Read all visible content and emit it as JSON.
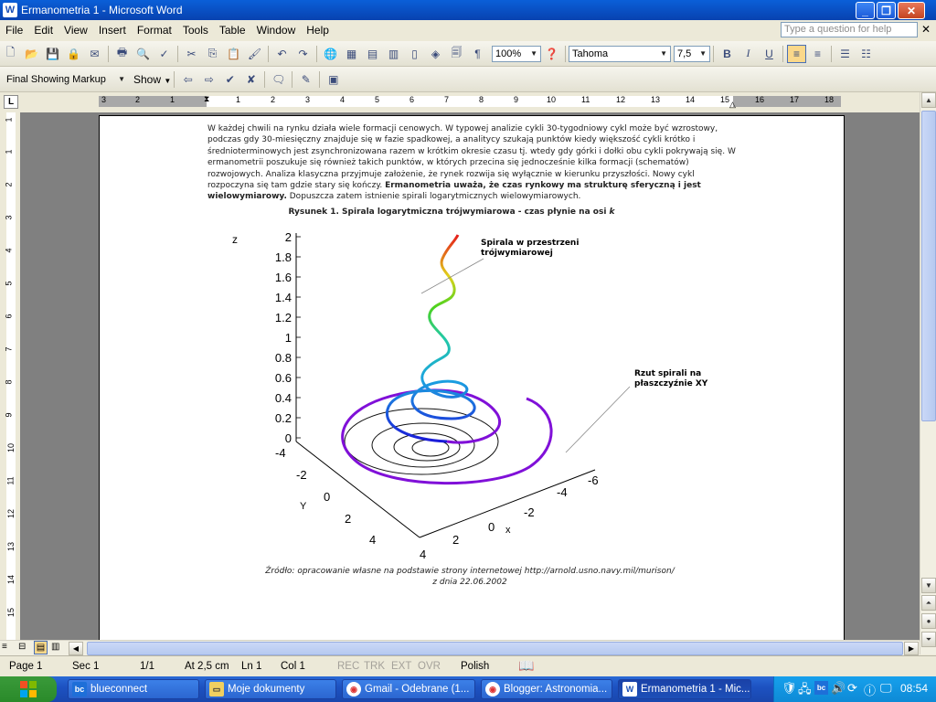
{
  "window": {
    "title": "Ermanometria 1 - Microsoft Word",
    "app_icon": "W"
  },
  "menu": [
    "File",
    "Edit",
    "View",
    "Insert",
    "Format",
    "Tools",
    "Table",
    "Window",
    "Help"
  ],
  "help_box": {
    "placeholder": "Type a question for help"
  },
  "standard_toolbar": {
    "zoom": "100%",
    "font": "Tahoma",
    "size": "7,5"
  },
  "reviewing_toolbar": {
    "display_mode": "Final Showing Markup",
    "show_label": "Show"
  },
  "ruler": {
    "numbers": [
      "3",
      "2",
      "1",
      "1",
      "2",
      "3",
      "4",
      "5",
      "6",
      "7",
      "8",
      "9",
      "10",
      "11",
      "12",
      "13",
      "14",
      "15",
      "16",
      "17",
      "18"
    ]
  },
  "vruler": {
    "numbers": [
      "1",
      "1",
      "2",
      "3",
      "4",
      "5",
      "6",
      "7",
      "8",
      "9",
      "10",
      "11",
      "12",
      "13",
      "14",
      "15"
    ]
  },
  "document": {
    "paragraph_part1": "W każdej chwili na rynku działa wiele formacji cenowych. W typowej analizie cykli 30-tygodniowy cykl może być wzrostowy, podczas gdy 30-miesięczny znajduje się w fazie spadkowej, a analitycy szukają punktów kiedy większość cykli krótko i średnioterminowych jest zsynchronizowana razem w krótkim okresie czasu tj. wtedy gdy górki i dołki obu cykli pokrywają się. W ermanometrii poszukuje się również takich punktów, w których przecina się jednocześnie kilka formacji (schematów) rozwojowych. Analiza klasyczna przyjmuje założenie, że rynek rozwija się wyłącznie w kierunku przyszłości. Nowy cykl rozpoczyna się tam gdzie stary się kończy. ",
    "paragraph_bold": "Ermanometria uważa, że czas rynkowy ma strukturę sferyczną i jest wielowymiarowy.",
    "paragraph_part2": " Dopuszcza zatem istnienie spirali logarytmicznych wielowymiarowych.",
    "caption_main": "Rysunek 1. Spirala logarytmiczna trójwymiarowa - czas płynie na osi",
    "caption_axis": "k",
    "source_line1": "Źródło: opracowanie własne na podstawie strony internetowej http://arnold.usno.navy.mil/murison/",
    "source_line2": "z dnia 22.06.2002"
  },
  "figure": {
    "z_label": "z",
    "y_label": "Y",
    "x_label": "x",
    "z_ticks": [
      "2",
      "1.8",
      "1.6",
      "1.4",
      "1.2",
      "1",
      "0.8",
      "0.6",
      "0.4",
      "0.2",
      "0"
    ],
    "y_ticks": [
      "-4",
      "-2",
      "0",
      "2",
      "4"
    ],
    "x_ticks": [
      "-6",
      "-4",
      "-2",
      "0",
      "2",
      "4"
    ],
    "annotation_spiral_line1": "Spirala w przestrzeni",
    "annotation_spiral_line2": "trójwymiarowej",
    "annotation_projection_line1": "Rzut spirali na",
    "annotation_projection_line2": "płaszczyźnie XY"
  },
  "status": {
    "page": "Page 1",
    "sec": "Sec 1",
    "pages": "1/1",
    "at": "At 2,5 cm",
    "ln": "Ln 1",
    "col": "Col 1",
    "rec": "REC",
    "trk": "TRK",
    "ext": "EXT",
    "ovr": "OVR",
    "lang": "Polish"
  },
  "taskbar": {
    "tasks": [
      "blueconnect",
      "Moje dokumenty",
      "Gmail - Odebrane (1...",
      "Blogger: Astronomia...",
      "Ermanometria 1 - Mic..."
    ],
    "clock": "08:54"
  },
  "colors": {
    "title_blue": "#0a5fd8",
    "taskbar_blue": "#1d52c2",
    "tray_blue": "#0e8ad6"
  }
}
